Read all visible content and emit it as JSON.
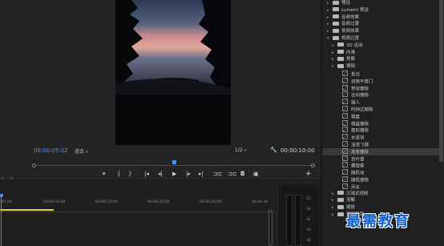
{
  "monitor": {
    "current_timecode": "00:00:05:02",
    "zoom_select": "适合",
    "resolution_select": "1/2",
    "duration_timecode": "00:00:10:00",
    "controls": [
      {
        "name": "add-marker-icon",
        "glyph": "▾"
      },
      {
        "name": "mark-in-icon",
        "glyph": "{"
      },
      {
        "name": "mark-out-icon",
        "glyph": "}"
      },
      {
        "name": "go-to-in-icon",
        "glyph": "|◂"
      },
      {
        "name": "step-back-icon",
        "glyph": "◂|"
      },
      {
        "name": "play-icon",
        "glyph": "▶"
      },
      {
        "name": "step-forward-icon",
        "glyph": "|▸"
      },
      {
        "name": "go-to-out-icon",
        "glyph": "▸|"
      },
      {
        "name": "lift-icon",
        "glyph": "⊐⊏"
      },
      {
        "name": "extract-icon",
        "glyph": "⊐⊏"
      },
      {
        "name": "export-frame-icon",
        "glyph": "◘"
      },
      {
        "name": "compare-view-icon",
        "glyph": "▣"
      }
    ],
    "add_button": "+",
    "playhead_fraction": 0.5
  },
  "timeline": {
    "ruler_labels": [
      ":05:00",
      "00:00:10:00",
      "00:00:15:00",
      "00:00:20:00",
      "00:00:25:00",
      "00:00:30"
    ],
    "meter_labels": [
      "-12",
      "-18",
      "-24",
      "-30",
      "-36"
    ],
    "tool_icons": [
      "snap-icon",
      "linked-selection-icon"
    ]
  },
  "effects": {
    "items": [
      {
        "label": "预设",
        "level": 0,
        "kind": "folder",
        "expanded": false
      },
      {
        "label": "Lumetri 预设",
        "level": 0,
        "kind": "folder",
        "expanded": false
      },
      {
        "label": "音频效果",
        "level": 0,
        "kind": "folder",
        "expanded": false
      },
      {
        "label": "音频过渡",
        "level": 0,
        "kind": "folder",
        "expanded": false
      },
      {
        "label": "视频效果",
        "level": 0,
        "kind": "folder",
        "expanded": false
      },
      {
        "label": "视频过渡",
        "level": 0,
        "kind": "folder",
        "expanded": true
      },
      {
        "label": "3D 运动",
        "level": 1,
        "kind": "folder",
        "expanded": false
      },
      {
        "label": "内滑",
        "level": 1,
        "kind": "folder",
        "expanded": false
      },
      {
        "label": "划像",
        "level": 1,
        "kind": "folder",
        "expanded": false
      },
      {
        "label": "擦除",
        "level": 1,
        "kind": "folder",
        "expanded": true
      },
      {
        "label": "划出",
        "level": 2,
        "kind": "effect"
      },
      {
        "label": "双侧平推门",
        "level": 2,
        "kind": "effect"
      },
      {
        "label": "带状擦除",
        "level": 2,
        "kind": "effect"
      },
      {
        "label": "径向擦除",
        "level": 2,
        "kind": "effect"
      },
      {
        "label": "插入",
        "level": 2,
        "kind": "effect"
      },
      {
        "label": "时钟式擦除",
        "level": 2,
        "kind": "effect"
      },
      {
        "label": "棋盘",
        "level": 2,
        "kind": "effect"
      },
      {
        "label": "棋盘擦除",
        "level": 2,
        "kind": "effect"
      },
      {
        "label": "楔形擦除",
        "level": 2,
        "kind": "effect"
      },
      {
        "label": "水波块",
        "level": 2,
        "kind": "effect"
      },
      {
        "label": "油漆飞溅",
        "level": 2,
        "kind": "effect"
      },
      {
        "label": "渐变擦除",
        "level": 2,
        "kind": "effect",
        "selected": true
      },
      {
        "label": "百叶窗",
        "level": 2,
        "kind": "effect"
      },
      {
        "label": "螺旋框",
        "level": 2,
        "kind": "effect"
      },
      {
        "label": "随机块",
        "level": 2,
        "kind": "effect"
      },
      {
        "label": "随机擦除",
        "level": 2,
        "kind": "effect"
      },
      {
        "label": "风车",
        "level": 2,
        "kind": "effect"
      },
      {
        "label": "沉浸式视频",
        "level": 1,
        "kind": "folder",
        "expanded": false
      },
      {
        "label": "溶解",
        "level": 1,
        "kind": "folder",
        "expanded": false
      },
      {
        "label": "缩放",
        "level": 1,
        "kind": "folder",
        "expanded": false
      },
      {
        "label": "页面剥落",
        "level": 1,
        "kind": "folder",
        "expanded": false
      }
    ]
  },
  "watermark": "最需教育",
  "colors": {
    "accent": "#3b8fff",
    "timecode": "#4d9cff",
    "workarea": "#e8d23a",
    "watermark": "#1560c8"
  }
}
